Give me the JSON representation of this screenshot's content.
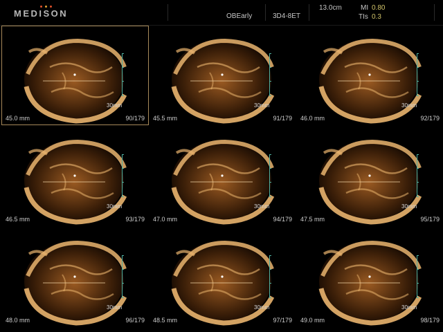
{
  "header": {
    "logo": "MEDISON",
    "preset": "OBEarly",
    "probe": "3D4-8ET",
    "depth": "13.0cm",
    "mi_label": "MI",
    "mi_value": "0.80",
    "tis_label": "TIs",
    "tis_value": "0.3",
    "logo_dot_colors": [
      "#e0502a",
      "#e0a030",
      "#e0502a"
    ]
  },
  "colors": {
    "tissue_dark": "#3a1e08",
    "tissue_mid": "#9a5a22",
    "tissue_bright": "#e9b46e",
    "selection": "#a88a5a",
    "ruler": "#4fb0a0"
  },
  "scale_label": "30mm",
  "slices": [
    {
      "depth": "45.0 mm",
      "frame": "90/179",
      "selected": true
    },
    {
      "depth": "45.5 mm",
      "frame": "91/179",
      "selected": false
    },
    {
      "depth": "46.0 mm",
      "frame": "92/179",
      "selected": false
    },
    {
      "depth": "46.5 mm",
      "frame": "93/179",
      "selected": false
    },
    {
      "depth": "47.0 mm",
      "frame": "94/179",
      "selected": false
    },
    {
      "depth": "47.5 mm",
      "frame": "95/179",
      "selected": false
    },
    {
      "depth": "48.0 mm",
      "frame": "96/179",
      "selected": false
    },
    {
      "depth": "48.5 mm",
      "frame": "97/179",
      "selected": false
    },
    {
      "depth": "49.0 mm",
      "frame": "98/179",
      "selected": false
    }
  ]
}
